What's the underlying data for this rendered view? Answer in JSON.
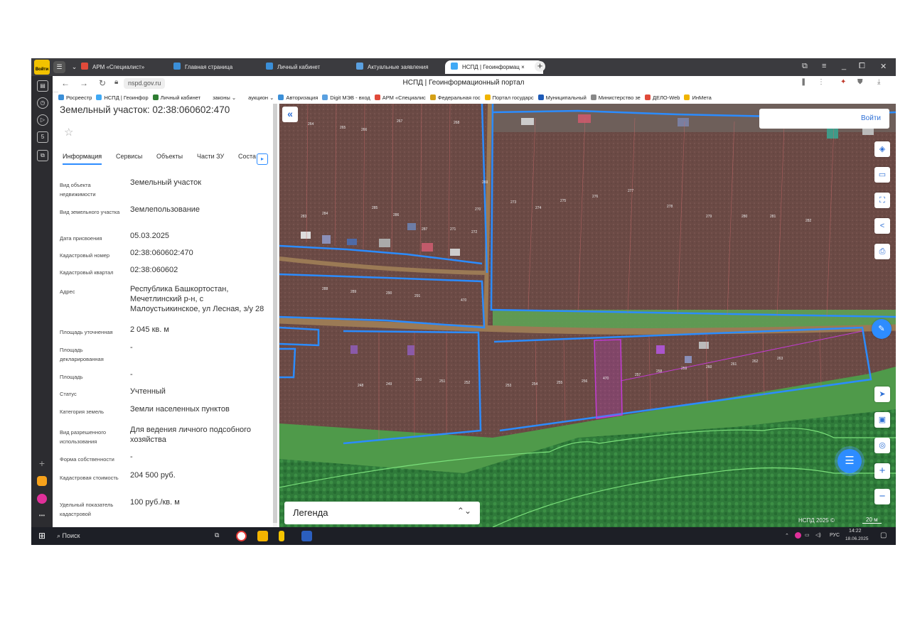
{
  "browser": {
    "logo_text": "Войти",
    "tabs": [
      {
        "label": "АРМ «Специалист»",
        "icon": "map-pin-icon",
        "color": "#e04a3a",
        "active": false
      },
      {
        "label": "Главная страница",
        "icon": "rosreestr-icon",
        "color": "#3b8fd8",
        "active": false
      },
      {
        "label": "Личный кабинет",
        "icon": "rosreestr-icon",
        "color": "#3b8fd8",
        "active": false
      },
      {
        "label": "Актуальные заявления",
        "icon": "document-icon",
        "color": "#5aa0e0",
        "active": false
      },
      {
        "label": "НСПД | Геоинформац",
        "icon": "nspd-icon",
        "color": "#3fa9f5",
        "active": true
      }
    ],
    "url": "nspd.gov.ru",
    "page_title": "НСПД | Геоинформационный портал",
    "bookmarks": [
      {
        "label": "Росреестр",
        "color": "#3b8fd8"
      },
      {
        "label": "НСПД | Геоинфор",
        "color": "#3fa9f5"
      },
      {
        "label": "Личный кабинет",
        "color": "#2e7d32"
      },
      {
        "label": "законы ⌄",
        "color": "#ffffff"
      },
      {
        "label": "аукцион ⌄",
        "color": "#ffffff"
      },
      {
        "label": "Авторизация",
        "color": "#3b8fd8"
      },
      {
        "label": "Digit МЭВ - вход",
        "color": "#5aa0e0"
      },
      {
        "label": "АРМ «Специалис",
        "color": "#e04a3a"
      },
      {
        "label": "Федеральная гос",
        "color": "#d4a017"
      },
      {
        "label": "Портал государс",
        "color": "#f0b400"
      },
      {
        "label": "Муниципальный",
        "color": "#1e5bb8"
      },
      {
        "label": "Министерство зе",
        "color": "#888888"
      },
      {
        "label": "ДЕЛО-Web",
        "color": "#e04a3a"
      },
      {
        "label": "ИнМета",
        "color": "#f0b400"
      }
    ]
  },
  "panel": {
    "title": "Земельный участок: 02:38:060602:470",
    "tabs": [
      "Информация",
      "Сервисы",
      "Объекты",
      "Части ЗУ",
      "Соста"
    ],
    "fields": [
      {
        "label": "Вид объекта недвижимости",
        "value": "Земельный участок"
      },
      {
        "label": "Вид земельного участка",
        "value": "Землепользование"
      },
      {
        "label": "Дата присвоения",
        "value": "05.03.2025"
      },
      {
        "label": "Кадастровый номер",
        "value": "02:38:060602:470"
      },
      {
        "label": "Кадастровый квартал",
        "value": "02:38:060602"
      },
      {
        "label": "Адрес",
        "value": "Республика Башкортостан, Мечетлинский р-н, с Малоустьикинское, ул Лесная, з/у 28"
      },
      {
        "label": "Площадь уточненная",
        "value": "2 045 кв. м"
      },
      {
        "label": "Площадь декларированная",
        "value": "-"
      },
      {
        "label": "Площадь",
        "value": "-"
      },
      {
        "label": "Статус",
        "value": "Учтенный"
      },
      {
        "label": "Категория земель",
        "value": "Земли населенных пунктов"
      },
      {
        "label": "Вид разрешенного использования",
        "value": "Для ведения личного подсобного хозяйства"
      },
      {
        "label": "Форма собственности",
        "value": "-"
      },
      {
        "label": "Кадастровая стоимость",
        "value": "204 500 руб."
      },
      {
        "label": "Удельный показатель кадастровой",
        "value": "100 руб./кв. м"
      }
    ]
  },
  "map": {
    "login_label": "Войти",
    "legend_label": "Легенда",
    "attribution": "НСПД 2025 ©",
    "scale_label": "20 м",
    "parcel_labels": [
      "470",
      "248",
      "249",
      "250",
      "251",
      "252",
      "253",
      "254",
      "255",
      "256",
      "257",
      "258",
      "259",
      "260",
      "261",
      "262",
      "263",
      "264",
      "265",
      "266",
      "267",
      "268",
      "269",
      "270",
      "271",
      "272",
      "273",
      "274",
      "275",
      "276",
      "277",
      "278",
      "279",
      "280",
      "281",
      "282",
      "283",
      "284",
      "285",
      "286",
      "287",
      "288",
      "289",
      "290",
      "291"
    ],
    "colors": {
      "boundary": "#2b8cff",
      "selected": "#c23bd4",
      "accent": "#2d6fd6"
    }
  },
  "taskbar": {
    "search_label": "Поиск",
    "lang": "РУС",
    "time": "14:22",
    "date": "18.06.2025"
  }
}
